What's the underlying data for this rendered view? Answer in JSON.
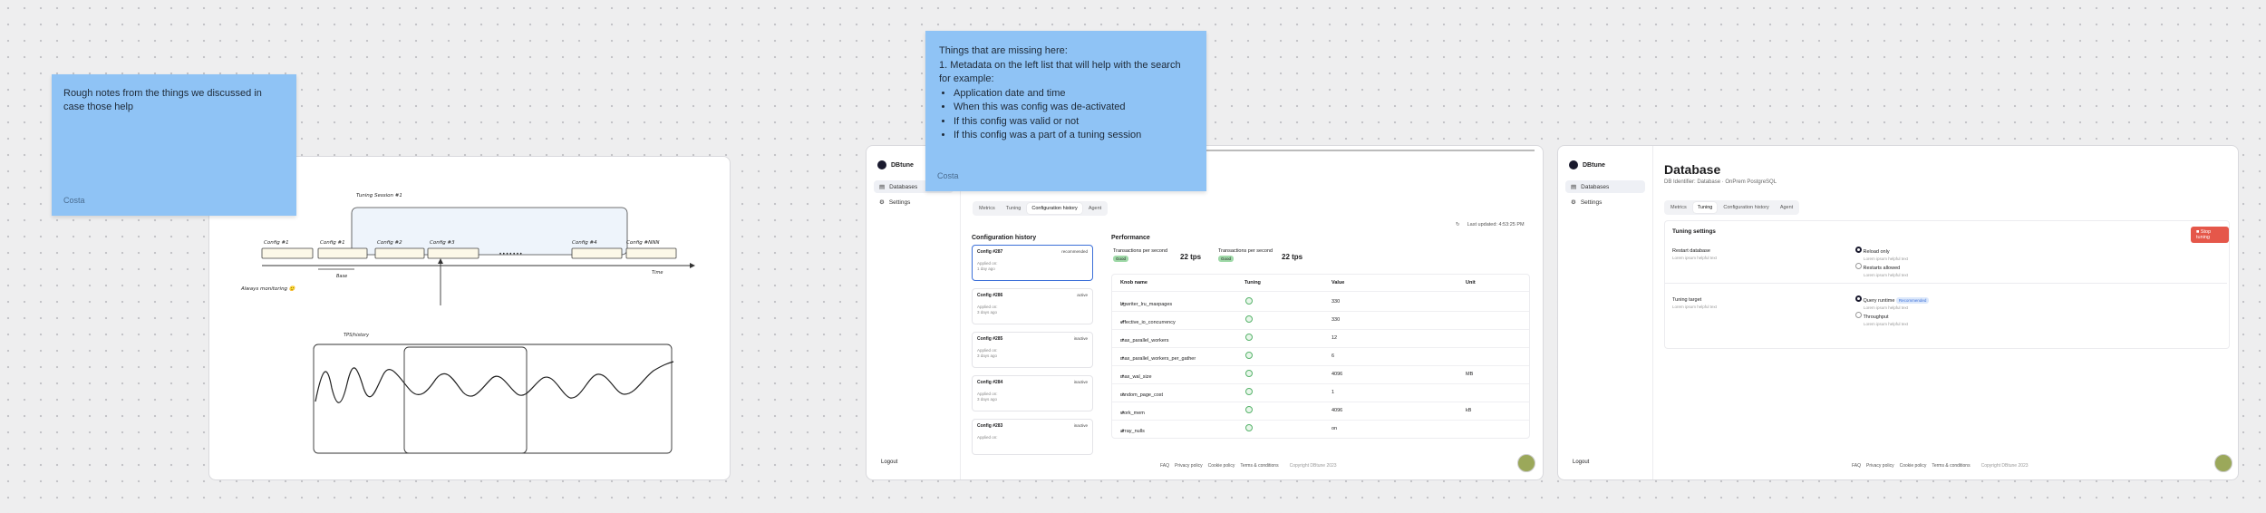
{
  "sticky_left": {
    "text": "Rough notes from the things we discussed in case those help",
    "author": "Costa"
  },
  "sticky_mid": {
    "intro": "Things that are missing here:",
    "line1": "1. Metadata on the left list that will help with the search for example:",
    "bullets": [
      "Application date and time",
      "When this was config was de-activated",
      "If this config was valid or not",
      "If this config was a part of a tuning session"
    ],
    "author": "Costa"
  },
  "sketch": {
    "tuning_session": "Tuning Session #1",
    "configs": [
      "Config #1",
      "Config #1",
      "Config #2",
      "Config #3",
      "Config #4",
      "Config #NNN"
    ],
    "dots": "• • • • • • •",
    "base": "Base",
    "time": "Time",
    "always": "Always monitoring 🙂",
    "metric": "TPS/history"
  },
  "app2": {
    "brand": "DBtune",
    "nav": [
      "Databases",
      "Settings"
    ],
    "logout": "Logout",
    "tabs": [
      "Metrics",
      "Tuning",
      "Configuration history",
      "Agent"
    ],
    "last_updated": "Last updated: 4:53:25 PM",
    "history_title": "Configuration history",
    "configs": [
      {
        "name": "Config #287",
        "badge": "recommended",
        "applied_label": "Applied on:",
        "applied": "1 day ago"
      },
      {
        "name": "Config #286",
        "badge": "active",
        "applied_label": "Applied on:",
        "applied": "3 days ago"
      },
      {
        "name": "Config #285",
        "badge": "inactive",
        "applied_label": "Applied on:",
        "applied": "3 days ago"
      },
      {
        "name": "Config #284",
        "badge": "inactive",
        "applied_label": "Applied on:",
        "applied": "3 days ago"
      },
      {
        "name": "Config #283",
        "badge": "inactive",
        "applied_label": "Applied on:",
        "applied": ""
      }
    ],
    "perf_title": "Performance",
    "metrics": [
      {
        "label": "Transactions per second",
        "badge": "Good",
        "value": "22 tps"
      },
      {
        "label": "Transactions per second",
        "badge": "Good",
        "value": "22 tps"
      }
    ],
    "table_headers": [
      "Knob name",
      "Tuning",
      "Value",
      "Unit"
    ],
    "rows": [
      {
        "name": "bgwriter_lru_maxpages",
        "value": "330",
        "unit": ""
      },
      {
        "name": "effective_io_concurrency",
        "value": "330",
        "unit": ""
      },
      {
        "name": "max_parallel_workers",
        "value": "12",
        "unit": ""
      },
      {
        "name": "max_parallel_workers_per_gather",
        "value": "6",
        "unit": ""
      },
      {
        "name": "max_wal_size",
        "value": "4096",
        "unit": "MB"
      },
      {
        "name": "random_page_cost",
        "value": "1",
        "unit": ""
      },
      {
        "name": "work_mem",
        "value": "4096",
        "unit": "kB"
      },
      {
        "name": "array_nulls",
        "value": "on",
        "unit": ""
      }
    ],
    "footer": [
      "FAQ",
      "Privacy policy",
      "Cookie policy",
      "Terms & conditions"
    ],
    "copyright": "Copyright DBtune 2023"
  },
  "app3": {
    "brand": "DBtune",
    "nav": [
      "Databases",
      "Settings"
    ],
    "logout": "Logout",
    "title": "Database",
    "subtitle": "DB Identifier: Database · OnPrem PostgreSQL",
    "tabs": [
      "Metrics",
      "Tuning",
      "Configuration history",
      "Agent"
    ],
    "section_title": "Tuning settings",
    "stop_button": "Stop tuning",
    "settings": [
      {
        "label": "Restart database",
        "hint": "Lorem ipsum helpful text",
        "options": [
          {
            "label": "Reload only",
            "hint": "Lorem ipsum helpful text",
            "selected": true
          },
          {
            "label": "Restarts allowed",
            "hint": "Lorem ipsum helpful text",
            "selected": false
          }
        ]
      },
      {
        "label": "Tuning target",
        "hint": "Lorem ipsum helpful text",
        "options": [
          {
            "label": "Query runtime",
            "tag": "Recommended",
            "hint": "Lorem ipsum helpful text",
            "selected": true
          },
          {
            "label": "Throughput",
            "hint": "Lorem ipsum helpful text",
            "selected": false
          }
        ]
      }
    ],
    "footer": [
      "FAQ",
      "Privacy policy",
      "Cookie policy",
      "Terms & conditions"
    ],
    "copyright": "Copyright DBtune 2023"
  },
  "colors": {
    "sticky": "#8fc3f5",
    "accent_blue": "#3b6fd8",
    "good_green": "#9fd9a8",
    "stop_red": "#e5574a",
    "dark": "#1a1a2e"
  }
}
